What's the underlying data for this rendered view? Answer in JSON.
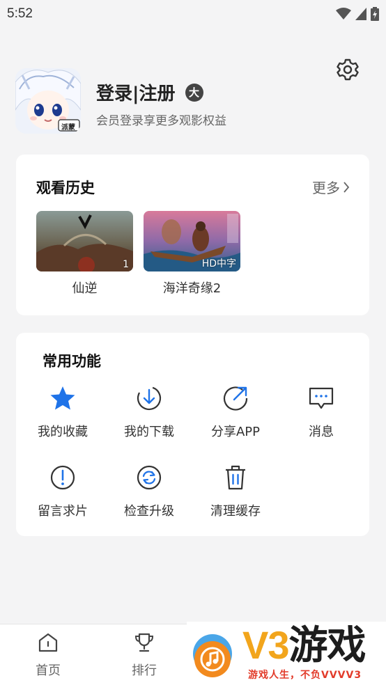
{
  "status_bar": {
    "time": "5:52"
  },
  "profile": {
    "login_label": "登录|注册",
    "badge": "大",
    "subtitle": "会员登录享更多观影权益",
    "avatar_tag": "派蒙"
  },
  "history": {
    "title": "观看历史",
    "more_label": "更多",
    "items": [
      {
        "title": "仙逆",
        "badge": "1"
      },
      {
        "title": "海洋奇缘2",
        "badge": "HD中字"
      }
    ]
  },
  "functions": {
    "title": "常用功能",
    "items": [
      {
        "label": "我的收藏",
        "icon": "star-icon"
      },
      {
        "label": "我的下载",
        "icon": "download-icon"
      },
      {
        "label": "分享APP",
        "icon": "share-icon"
      },
      {
        "label": "消息",
        "icon": "message-icon"
      },
      {
        "label": "留言求片",
        "icon": "exclamation-icon"
      },
      {
        "label": "检查升级",
        "icon": "refresh-icon"
      },
      {
        "label": "清理缓存",
        "icon": "trash-icon"
      }
    ]
  },
  "bottom_nav": {
    "items": [
      {
        "label": "首页",
        "icon": "home-icon"
      },
      {
        "label": "排行",
        "icon": "trophy-icon"
      }
    ]
  },
  "watermark": {
    "brand_v3": "V3",
    "brand_game": "游戏",
    "slogan": "游戏人生，不负VVVV3"
  },
  "colors": {
    "accent_blue": "#1f73e8",
    "background": "#f4f4f5",
    "card": "#ffffff",
    "watermark_orange": "#f2a51c",
    "watermark_red": "#e23b2a"
  }
}
